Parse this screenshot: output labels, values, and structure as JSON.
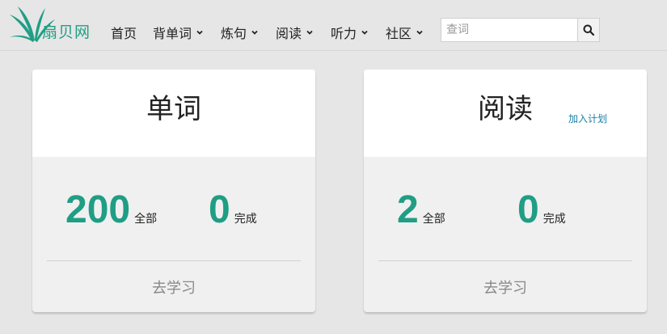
{
  "nav": {
    "logo_text": "扇贝网",
    "items": [
      {
        "label": "首页",
        "has_dropdown": false
      },
      {
        "label": "背单词",
        "has_dropdown": true
      },
      {
        "label": "炼句",
        "has_dropdown": true
      },
      {
        "label": "阅读",
        "has_dropdown": true
      },
      {
        "label": "听力",
        "has_dropdown": true
      },
      {
        "label": "社区",
        "has_dropdown": true
      }
    ],
    "search_placeholder": "查词",
    "search_icon": "search-icon"
  },
  "cards": [
    {
      "title": "单词",
      "add_plan_label": "",
      "total_value": "200",
      "total_label": "全部",
      "done_value": "0",
      "done_label": "完成",
      "action_label": "去学习"
    },
    {
      "title": "阅读",
      "add_plan_label": "加入计划",
      "total_value": "2",
      "total_label": "全部",
      "done_value": "0",
      "done_label": "完成",
      "action_label": "去学习"
    }
  ],
  "colors": {
    "brand": "#209e85",
    "link": "#1a80a8",
    "background": "#e6e6e6"
  }
}
